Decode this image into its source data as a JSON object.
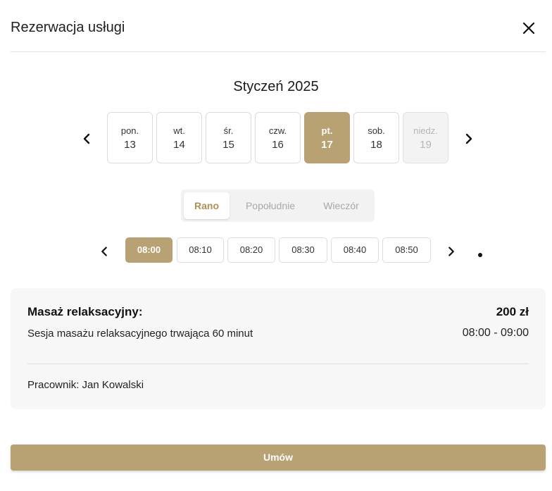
{
  "modal": {
    "title": "Rezerwacja usługi",
    "close_icon": "close-icon"
  },
  "calendar": {
    "month_label": "Styczeń 2025",
    "prev_icon": "chevron-left-icon",
    "next_icon": "chevron-right-icon",
    "days": [
      {
        "name": "pon.",
        "date": "13",
        "state": "default"
      },
      {
        "name": "wt.",
        "date": "14",
        "state": "default"
      },
      {
        "name": "śr.",
        "date": "15",
        "state": "default"
      },
      {
        "name": "czw.",
        "date": "16",
        "state": "default"
      },
      {
        "name": "pt.",
        "date": "17",
        "state": "selected"
      },
      {
        "name": "sob.",
        "date": "18",
        "state": "default"
      },
      {
        "name": "niedz.",
        "date": "19",
        "state": "disabled"
      }
    ]
  },
  "time_of_day": {
    "tabs": [
      {
        "label": "Rano",
        "active": true
      },
      {
        "label": "Popołudnie",
        "active": false
      },
      {
        "label": "Wieczór",
        "active": false
      }
    ]
  },
  "time_slots": {
    "prev_icon": "chevron-left-icon",
    "next_icon": "chevron-right-icon",
    "slots": [
      {
        "label": "08:00",
        "selected": true
      },
      {
        "label": "08:10",
        "selected": false
      },
      {
        "label": "08:20",
        "selected": false
      },
      {
        "label": "08:30",
        "selected": false
      },
      {
        "label": "08:40",
        "selected": false
      },
      {
        "label": "08:50",
        "selected": false
      }
    ]
  },
  "summary": {
    "service_name": "Masaż relaksacyjny:",
    "price": "200 zł",
    "description": "Sesja masażu relaksacyjnego trwająca 60 minut",
    "time_range": "08:00 - 09:00",
    "staff": "Pracownik: Jan Kowalski"
  },
  "actions": {
    "submit_label": "Umów"
  },
  "colors": {
    "accent": "#b8a173",
    "accent_text": "#b08f55",
    "card_bg": "#f7f7f7",
    "disabled_bg": "#f3f3f3"
  }
}
